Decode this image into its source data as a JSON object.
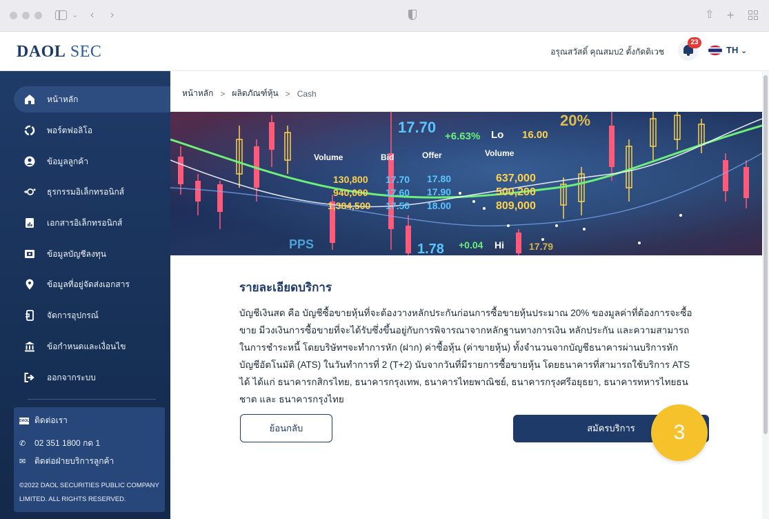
{
  "header": {
    "logo_primary": "DAOL",
    "logo_secondary": "SEC",
    "greeting": "อรุณสวัสดิ์ คุณสมบ2 ตั้งกัดดิเวช",
    "notification_count": "23",
    "language": "TH",
    "lang_chevron": "⌄"
  },
  "sidebar": {
    "items": [
      {
        "label": "หน้าหลัก",
        "icon": "home-icon",
        "active": true
      },
      {
        "label": "พอร์ตฟอลิโอ",
        "icon": "portfolio-icon",
        "active": false
      },
      {
        "label": "ข้อมูลลูกค้า",
        "icon": "user-icon",
        "active": false
      },
      {
        "label": "ธุรกรรมอิเล็กทรอนิกส์",
        "icon": "transaction-icon",
        "active": false
      },
      {
        "label": "เอกสารอิเล็กทรอนิกส์",
        "icon": "document-icon",
        "active": false
      },
      {
        "label": "ข้อมูลบัญชีลงทุน",
        "icon": "account-icon",
        "active": false
      },
      {
        "label": "ข้อมูลที่อยู่จัดส่งเอกสาร",
        "icon": "location-icon",
        "active": false
      },
      {
        "label": "จัดการอุปกรณ์",
        "icon": "device-icon",
        "active": false
      },
      {
        "label": "ข้อกำหนดและเงื่อนไข",
        "icon": "bank-icon",
        "active": false
      },
      {
        "label": "ออกจากระบบ",
        "icon": "logout-icon",
        "active": false
      }
    ],
    "contact": {
      "logo_text": "DAOL",
      "title": "ติดต่อเรา",
      "phone": "02 351 1800 กด 1",
      "service": "ติดต่อฝ่ายบริการลูกค้า",
      "copyright_line1": "©2022 DAOL SECURITIES PUBLIC COMPANY",
      "copyright_line2": "LIMITED. ALL RIGHTS RESERVED."
    }
  },
  "breadcrumb": {
    "items": [
      "หน้าหลัก",
      "ผลิตภัณฑ์หุ้น",
      "Cash"
    ],
    "separator": ">"
  },
  "banner": {
    "price": "17.70",
    "change_pct": "+6.63%",
    "lo_label": "Lo",
    "lo_value": "16.00",
    "pct_value": "20%",
    "columns": [
      "Volume",
      "Bid",
      "Offer",
      "Volume"
    ],
    "rows": [
      [
        "130,800",
        "17.70",
        "17.80",
        "637,000"
      ],
      [
        "940,000",
        "17.60",
        "17.90",
        "500,200"
      ],
      [
        "1,384,500",
        "17.50",
        "18.00",
        "809,000"
      ]
    ],
    "pps": "PPS",
    "bottom_price": "1.78",
    "bottom_change": "+0.04",
    "hi_label": "Hi",
    "hi_value": "17.79"
  },
  "content": {
    "title": "รายละเอียดบริการ",
    "description": "บัญชีเงินสด คือ บัญชีซื้อขายหุ้นที่จะต้องวางหลักประกันก่อนการซื้อขายหุ้นประมาณ 20% ของมูลค่าที่ต้องการจะซื้อขาย มีวงเงินการซื้อขายที่จะได้รับซึ่งขึ้นอยู่กับการพิจารณาจากหลักฐานทางการเงิน หลักประกัน และความสามารถในการชำระหนี้ โดยบริษัทฯจะทำการหัก (ฝาก) ค่าซื้อหุ้น (ค่าขายหุ้น) ทั้งจำนวนจากบัญชีธนาคารผ่านบริการหักบัญชีอัตโนมัติ (ATS) ในวันทำการที่ 2 (T+2) นับจากวันที่มีรายการซื้อขายหุ้น โดยธนาคารที่สามารถใช้บริการ ATS ได้ ได้แก่ ธนาคารกสิกรไทย, ธนาคารกรุงเทพ, ธนาคารไทยพาณิชย์, ธนาคารกรุงศรีอยุธยา, ธนาคารทหารไทยธนชาต และ ธนาคารกรุงไทย",
    "back_label": "ย้อนกลับ",
    "apply_label": "สมัครบริการ",
    "step_number": "3"
  },
  "colors": {
    "brand": "#1e3a68",
    "sidebar_bg": "#1f3b68",
    "step_badge": "#f5c22b",
    "notification": "#e53935"
  }
}
